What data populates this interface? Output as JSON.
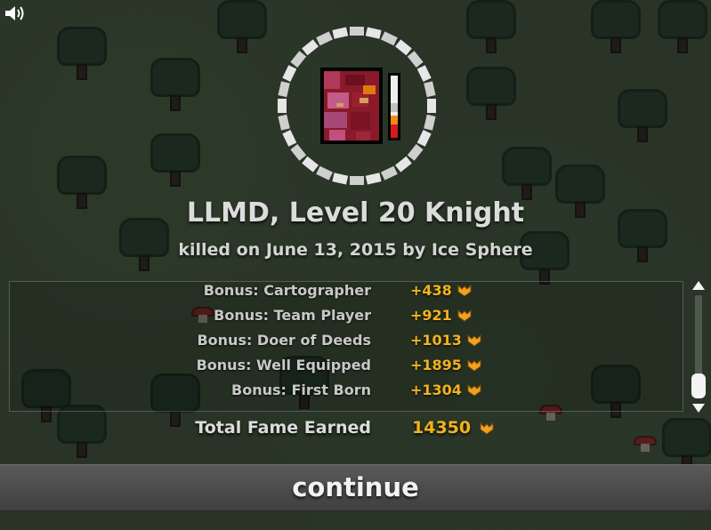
{
  "character": {
    "title": "LLMD, Level 20 Knight",
    "death_line": "killed on June 13, 2015 by Ice Sphere"
  },
  "bonuses": [
    {
      "label": "Bonus: Cartographer",
      "value": "+438"
    },
    {
      "label": "Bonus: Team Player",
      "value": "+921"
    },
    {
      "label": "Bonus: Doer of Deeds",
      "value": "+1013"
    },
    {
      "label": "Bonus: Well Equipped",
      "value": "+1895"
    },
    {
      "label": "Bonus: First Born",
      "value": "+1304"
    }
  ],
  "total": {
    "label": "Total Fame Earned",
    "value": "14350"
  },
  "continue_label": "continue",
  "icons": {
    "sound": "speaker-icon",
    "fame": "fame-icon",
    "scroll_up": "arrow-up-icon",
    "scroll_down": "arrow-down-icon"
  },
  "colors": {
    "fame": "#f2b31d",
    "text": "#dcdcdc",
    "button": "#4c4c4c"
  }
}
